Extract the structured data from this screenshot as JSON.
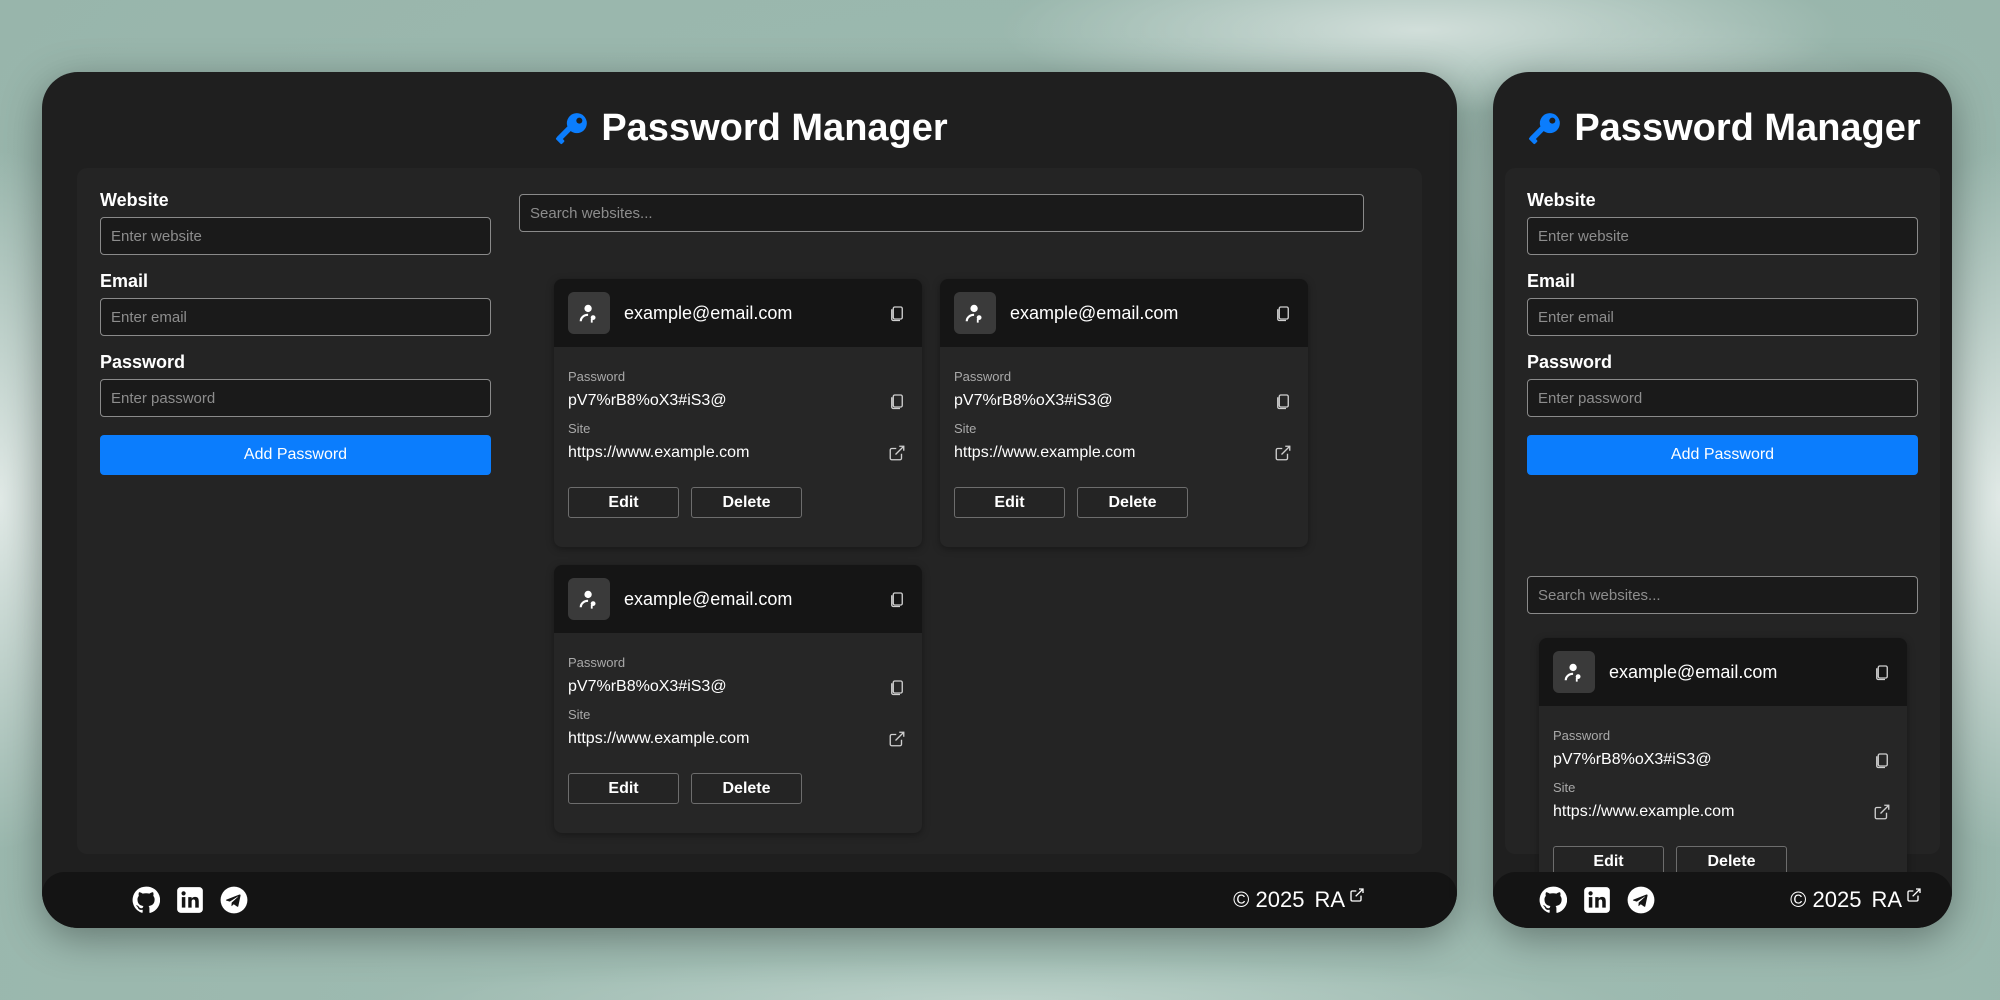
{
  "app": {
    "title": "Password Manager",
    "accent_color": "#0b7dfd",
    "title_icon": "key-icon"
  },
  "form": {
    "website_label": "Website",
    "website_placeholder": "Enter website",
    "email_label": "Email",
    "email_placeholder": "Enter email",
    "password_label": "Password",
    "password_placeholder": "Enter password",
    "add_button": "Add Password"
  },
  "search": {
    "placeholder": "Search websites..."
  },
  "entries": [
    {
      "email": "example@email.com",
      "password_label": "Password",
      "password": "pV7%rB8%oX3#iS3@",
      "site_label": "Site",
      "site": "https://www.example.com",
      "edit_label": "Edit",
      "delete_label": "Delete"
    },
    {
      "email": "example@email.com",
      "password_label": "Password",
      "password": "pV7%rB8%oX3#iS3@",
      "site_label": "Site",
      "site": "https://www.example.com",
      "edit_label": "Edit",
      "delete_label": "Delete"
    },
    {
      "email": "example@email.com",
      "password_label": "Password",
      "password": "pV7%rB8%oX3#iS3@",
      "site_label": "Site",
      "site": "https://www.example.com",
      "edit_label": "Edit",
      "delete_label": "Delete"
    }
  ],
  "footer": {
    "social_icons": [
      "github-icon",
      "linkedin-icon",
      "telegram-icon"
    ],
    "copyright": "© 2025",
    "author": "RA"
  }
}
